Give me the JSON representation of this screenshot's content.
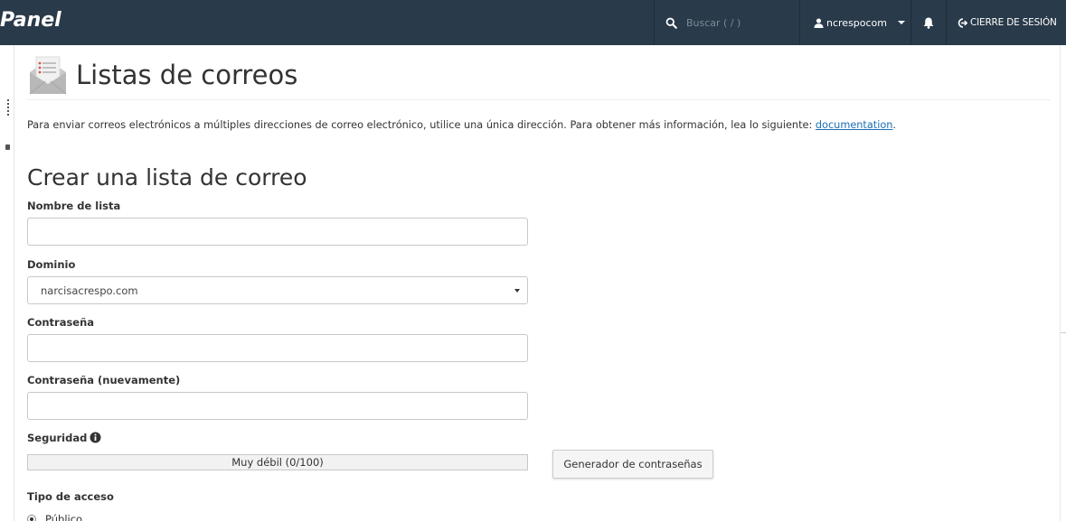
{
  "topbar": {
    "brand": "Panel",
    "search_placeholder": "Buscar ( / )",
    "username": "ncrespocom",
    "logout_label": "CIERRE DE SESIÓN"
  },
  "header": {
    "title": "Listas de correos",
    "intro_text": "Para enviar correos electrónicos a múltiples direcciones de correo electrónico, utilice una única dirección. Para obtener más información, lea lo siguiente: ",
    "doc_link": "documentation",
    "intro_end": "."
  },
  "form": {
    "section_title": "Crear una lista de correo",
    "list_name_label": "Nombre de lista",
    "list_name_value": "",
    "domain_label": "Dominio",
    "domain_selected": "narcisacrespo.com",
    "password_label": "Contraseña",
    "password_value": "",
    "password_again_label": "Contraseña (nuevamente)",
    "password_again_value": "",
    "security_label": "Seguridad",
    "strength_text": "Muy débil (0/100)",
    "strength_value": 0,
    "generator_button": "Generador de contraseñas",
    "access_type_label": "Tipo de acceso",
    "access_public": "Público"
  },
  "colors": {
    "topbar_bg": "#293a4a",
    "link": "#1b6fb5",
    "meter_bg": "#f2f2f2"
  },
  "icons": {
    "search": "search-icon",
    "user": "user-icon",
    "caret": "caret-down-icon",
    "bell": "bell-icon",
    "logout": "sign-out-icon",
    "page": "mailing-list-icon",
    "info": "info-circle-icon"
  }
}
